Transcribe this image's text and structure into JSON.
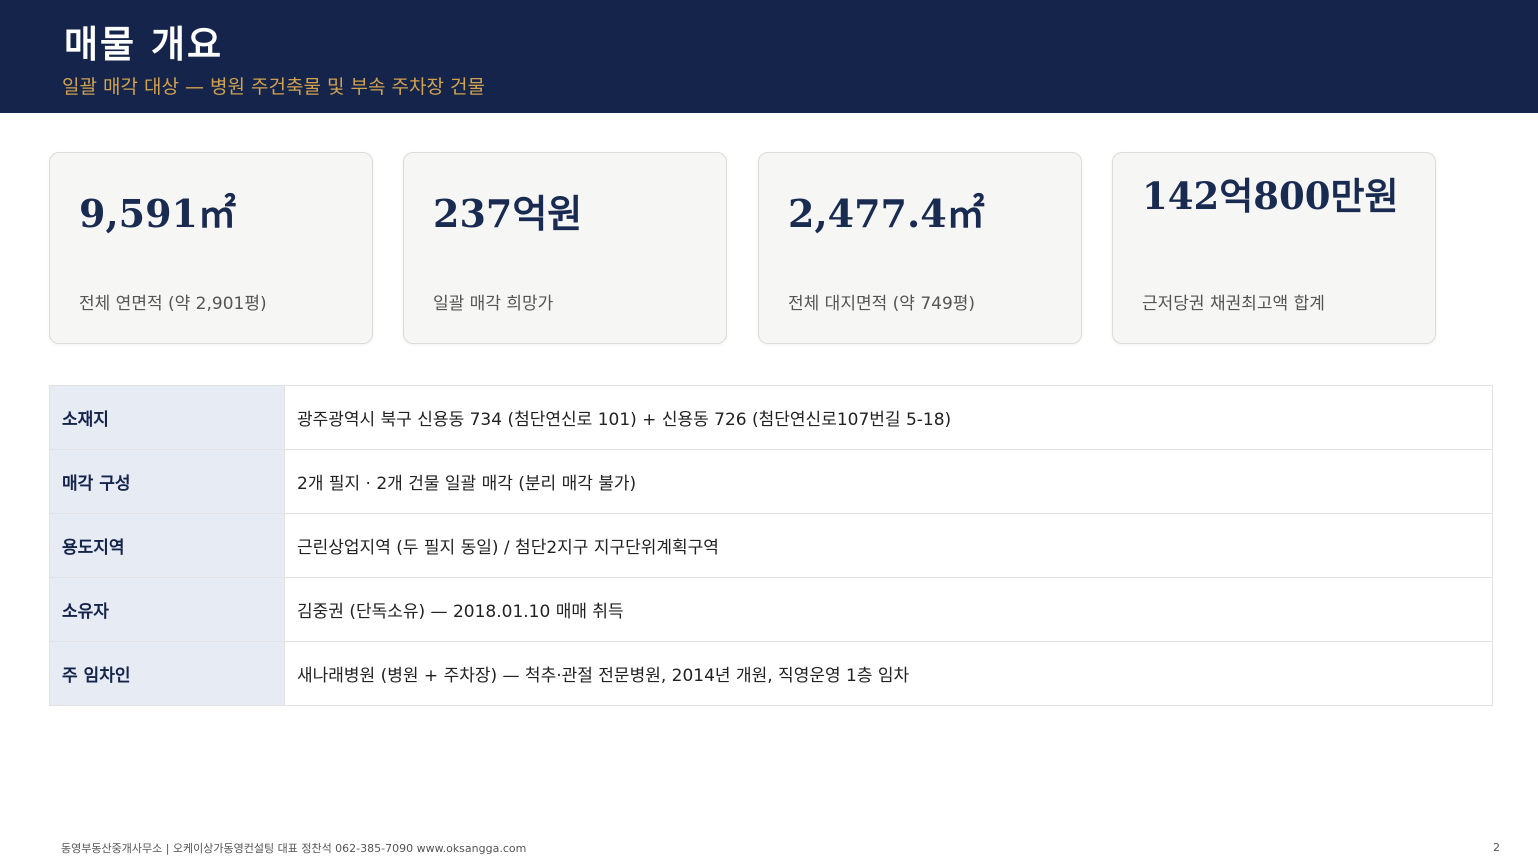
{
  "header": {
    "title": "매물 개요",
    "subtitle": "일괄 매각 대상 — 병원 주건축물 및 부속 주차장 건물"
  },
  "cards": [
    {
      "value": "9,591㎡",
      "label": "전체 연면적 (약 2,901평)"
    },
    {
      "value": "237억원",
      "label": "일괄 매각 희망가"
    },
    {
      "value": "2,477.4㎡",
      "label": "전체 대지면적 (약 749평)"
    },
    {
      "value": "142억800만원",
      "label": "근저당권 채권최고액 합계"
    }
  ],
  "table": {
    "rows": [
      {
        "key": "소재지",
        "value": "광주광역시 북구 신용동 734 (첨단연신로 101) + 신용동 726 (첨단연신로107번길 5-18)"
      },
      {
        "key": "매각 구성",
        "value": "2개 필지 · 2개 건물 일괄 매각 (분리 매각 불가)"
      },
      {
        "key": "용도지역",
        "value": "근린상업지역 (두 필지 동일) / 첨단2지구 지구단위계획구역"
      },
      {
        "key": "소유자",
        "value": "김중권 (단독소유) — 2018.01.10 매매 취득"
      },
      {
        "key": "주 임차인",
        "value": "새나래병원 (병원 + 주차장) — 척추·관절 전문병원, 2014년 개원, 직영운영 1층 임차"
      }
    ]
  },
  "footer": {
    "text": "동영부동산중개사무소 | 오케이상가동영컨설팅   대표 정찬석  062-385-7090 www.oksangga.com",
    "page_number": "2"
  }
}
